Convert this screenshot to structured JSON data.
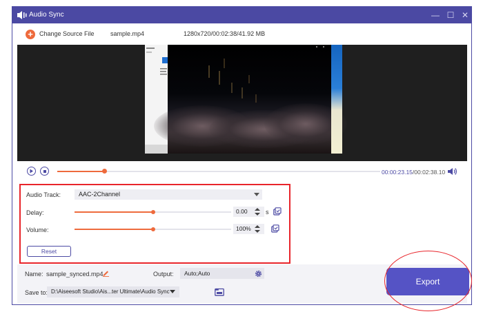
{
  "window": {
    "title": "Audio Sync",
    "minimize_glyph": "—",
    "maximize_glyph": "☐",
    "close_glyph": "✕"
  },
  "toolbar": {
    "change_source_label": "Change Source File",
    "add_glyph": "+",
    "file_name": "sample.mp4",
    "file_info": "1280x720/00:02:38/41.92 MB"
  },
  "player": {
    "progress": 0.146,
    "time_current": "00:00:23.15",
    "time_total": "/00:02:38.10"
  },
  "settings": {
    "audio_track_label": "Audio Track:",
    "audio_track_value": "AAC-2Channel",
    "delay_label": "Delay:",
    "delay_value": "0.00",
    "delay_unit": "s",
    "delay_level": 0.5,
    "volume_label": "Volume:",
    "volume_value": "100%",
    "volume_level": 0.5,
    "reset_label": "Reset"
  },
  "bottom": {
    "name_label": "Name:",
    "name_value": "sample_synced.mp4",
    "output_label": "Output:",
    "output_value": "Auto;Auto",
    "save_label": "Save to:",
    "save_value": "D:\\Aiseesoft Studio\\Ais...ter Ultimate\\Audio Sync",
    "export_label": "Export"
  },
  "colors": {
    "accent": "#4b49a3",
    "orange": "#ee6a3c",
    "export": "#5553c5",
    "highlight": "#e8242a"
  }
}
